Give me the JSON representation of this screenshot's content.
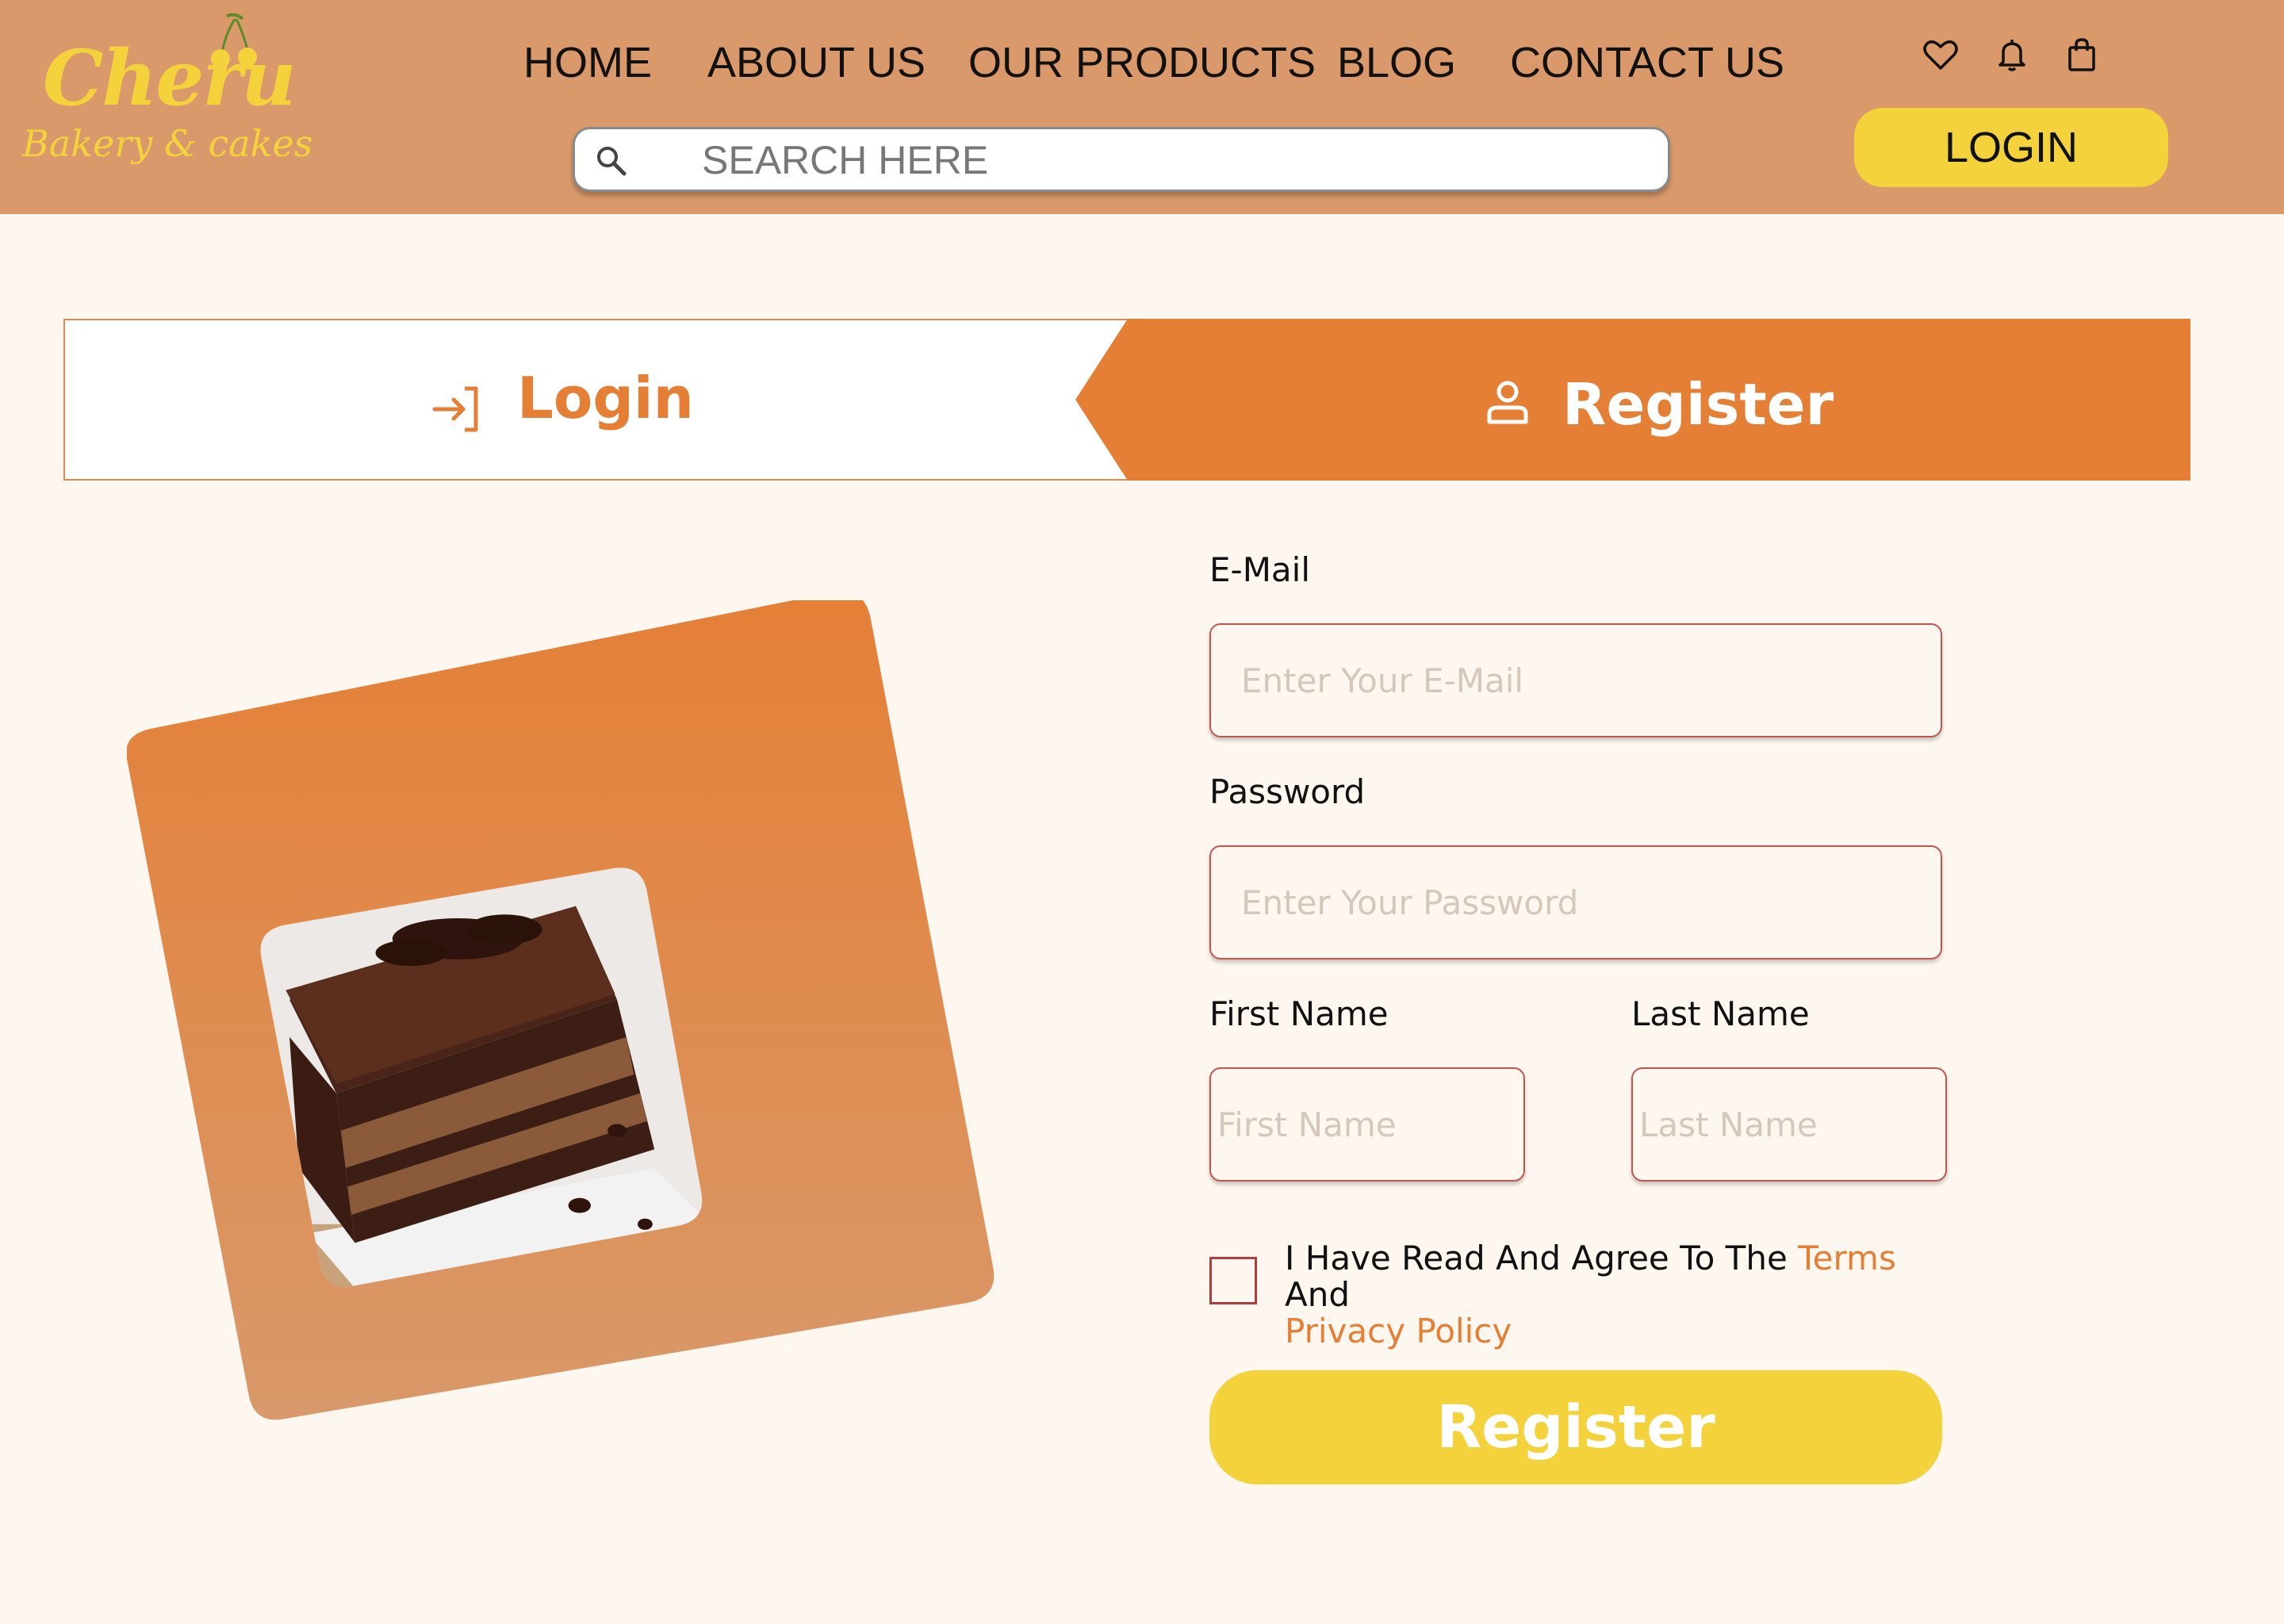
{
  "brand": {
    "name": "Cheru",
    "tagline": "Bakery & cakes",
    "accent": "#f4d23c",
    "header_bg": "#d9996a",
    "primary": "#e57f36"
  },
  "nav": {
    "items": [
      {
        "label": "HOME"
      },
      {
        "label": "ABOUT US"
      },
      {
        "label": "OUR PRODUCTS"
      },
      {
        "label": "BLOG"
      },
      {
        "label": "CONTACT US"
      }
    ]
  },
  "search": {
    "placeholder": "SEARCH HERE",
    "value": ""
  },
  "header_icons": [
    "heart-icon",
    "bell-icon",
    "shopping-bag-icon"
  ],
  "header_login": {
    "label": "LOGIN"
  },
  "tabs": {
    "login": {
      "label": "Login",
      "icon": "login-icon"
    },
    "register": {
      "label": "Register",
      "icon": "user-icon",
      "active": true
    }
  },
  "form": {
    "email": {
      "label": "E-Mail",
      "placeholder": "Enter Your E-Mail",
      "value": ""
    },
    "password": {
      "label": "Password",
      "placeholder": "Enter Your Password",
      "value": ""
    },
    "first_name": {
      "label": "First Name",
      "placeholder": "First Name",
      "value": ""
    },
    "last_name": {
      "label": "Last Name",
      "placeholder": "Last Name",
      "value": ""
    },
    "agree": {
      "prefix": "I Have Read And Agree To The ",
      "terms": "Terms",
      "middle": " And",
      "privacy": "Privacy Policy",
      "checked": false
    },
    "submit": {
      "label": "Register"
    }
  }
}
